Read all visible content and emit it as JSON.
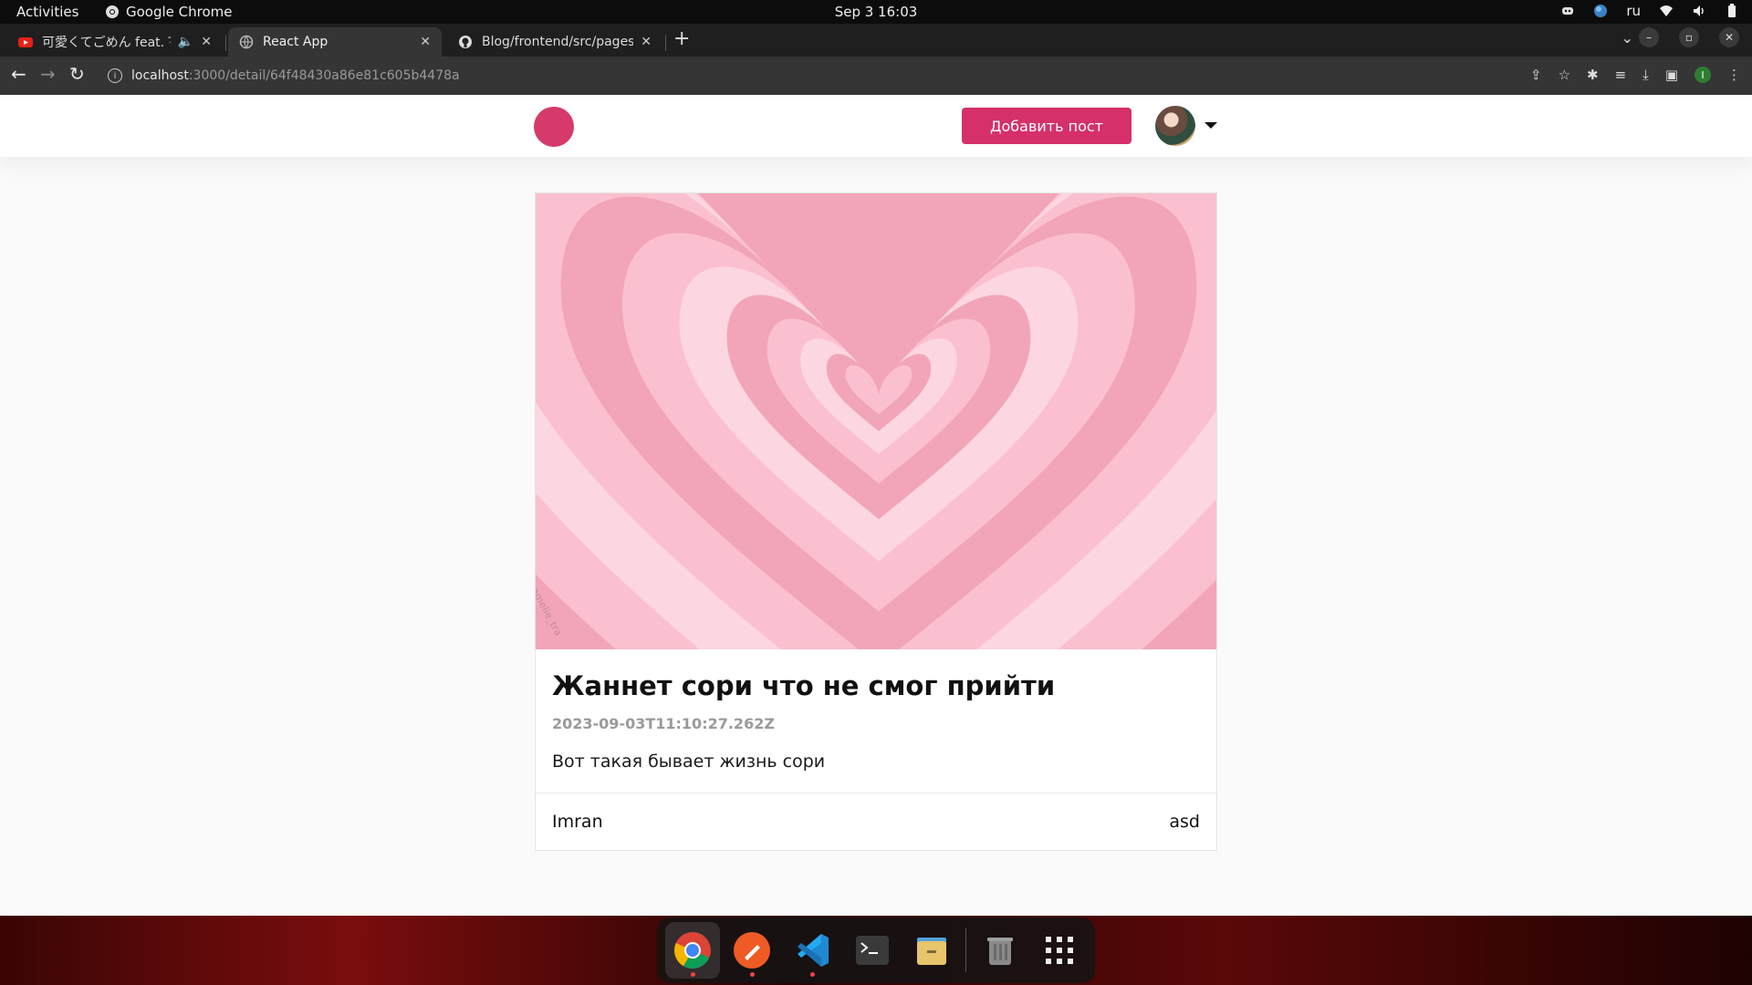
{
  "system_bar": {
    "activities": "Activities",
    "app_name": "Google Chrome",
    "clock": "Sep 3  16:03",
    "keyboard_layout": "ru"
  },
  "browser": {
    "tabs": [
      {
        "title": "可愛くてごめん feat. Ŧ",
        "favicon": "youtube-icon",
        "audio": true,
        "active": false
      },
      {
        "title": "React App",
        "favicon": "globe-icon",
        "active": true
      },
      {
        "title": "Blog/frontend/src/pages",
        "favicon": "github-icon",
        "active": false
      }
    ],
    "url_host": "localhost",
    "url_path": ":3000/detail/64f48430a86e81c605b4478a"
  },
  "site": {
    "add_post_label": "Добавить пост",
    "brand_color": "#d5306a"
  },
  "post": {
    "title": "Жаннет сори что не смог прийти",
    "date": "2023-09-03T11:10:27.262Z",
    "text": "Вот такая бывает жизнь сори",
    "author": "Imran",
    "tag": "asd",
    "image_watermark": "amelie_tra"
  },
  "dock": {
    "apps": [
      "chrome-icon",
      "postman-icon",
      "vscode-icon",
      "terminal-icon",
      "files-icon",
      "trash-icon",
      "app-grid-icon"
    ]
  }
}
